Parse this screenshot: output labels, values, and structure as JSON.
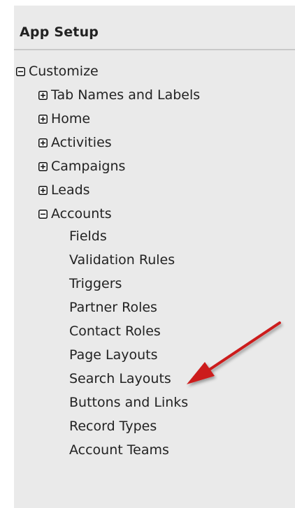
{
  "setup": {
    "title": "App Setup",
    "tree": {
      "customize": {
        "label": "Customize",
        "state": "expanded",
        "children": [
          {
            "label": "Tab Names and Labels",
            "state": "collapsed"
          },
          {
            "label": "Home",
            "state": "collapsed"
          },
          {
            "label": "Activities",
            "state": "collapsed"
          },
          {
            "label": "Campaigns",
            "state": "collapsed"
          },
          {
            "label": "Leads",
            "state": "collapsed"
          }
        ],
        "accounts": {
          "label": "Accounts",
          "state": "expanded",
          "items": [
            "Fields",
            "Validation Rules",
            "Triggers",
            "Partner Roles",
            "Contact Roles",
            "Page Layouts",
            "Search Layouts",
            "Buttons and Links",
            "Record Types",
            "Account Teams"
          ]
        }
      }
    }
  },
  "colors": {
    "panel_background": "#eaeaea",
    "divider": "#c9c9c9",
    "text": "#222222",
    "annotation_arrow": "#cc1f1f"
  },
  "icons": {
    "expanded": "minus-box-icon",
    "collapsed": "plus-box-icon",
    "annotation": "red-arrow"
  }
}
